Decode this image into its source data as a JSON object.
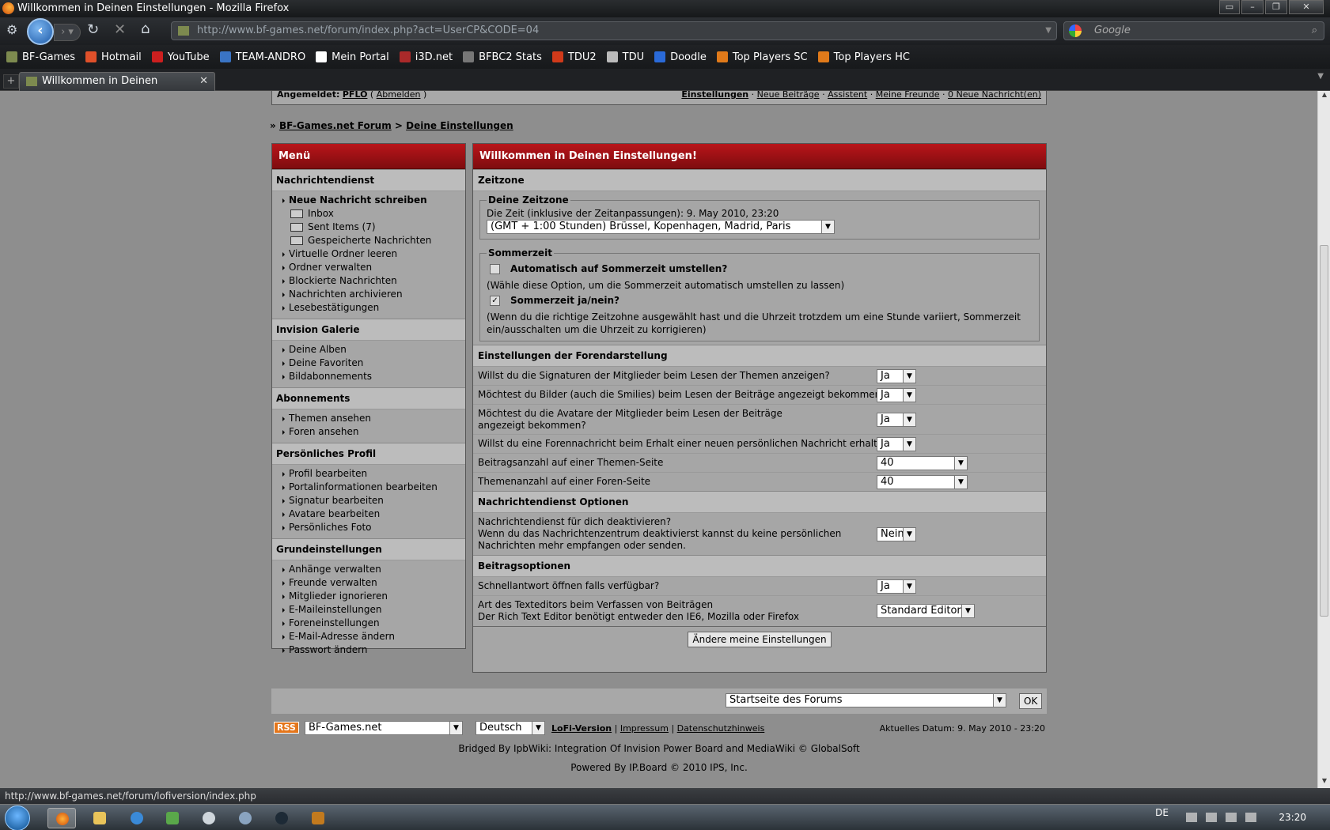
{
  "window": {
    "title": "Willkommen in Deinen Einstellungen - Mozilla Firefox"
  },
  "nav": {
    "url": "http://www.bf-games.net/forum/index.php?act=UserCP&CODE=04",
    "search_placeholder": "Google"
  },
  "bookmarks": [
    {
      "label": "BF-Games",
      "color": "#7d8a4f"
    },
    {
      "label": "Hotmail",
      "color": "#e0502a"
    },
    {
      "label": "YouTube",
      "color": "#cc1f1f"
    },
    {
      "label": "TEAM-ANDRO",
      "color": "#3a74c4"
    },
    {
      "label": "Mein Portal",
      "color": "#ffffff"
    },
    {
      "label": "i3D.net",
      "color": "#aa2a2a"
    },
    {
      "label": "BFBC2 Stats",
      "color": "#777777"
    },
    {
      "label": "TDU2",
      "color": "#d03a1a"
    },
    {
      "label": "TDU",
      "color": "#bbbbbb"
    },
    {
      "label": "Doodle",
      "color": "#2a6ad8"
    },
    {
      "label": "Top Players SC",
      "color": "#e07a1a"
    },
    {
      "label": "Top Players HC",
      "color": "#e07a1a"
    }
  ],
  "tab": {
    "label": "Willkommen in Deinen Einstellun..."
  },
  "userbar": {
    "left_prefix": "Angemeldet:",
    "user": "PFLO",
    "logout": "Abmelden",
    "links": [
      "Einstellungen",
      "Neue Beiträge",
      "Assistent",
      "Meine Freunde",
      "0 Neue Nachricht(en)"
    ]
  },
  "breadcrumb": {
    "root": "BF-Games.net Forum",
    "current": "Deine Einstellungen"
  },
  "menu": {
    "title": "Menü",
    "sections": [
      {
        "title": "Nachrichtendienst"
      },
      {
        "title": "Invision Galerie"
      },
      {
        "title": "Abonnements"
      },
      {
        "title": "Persönliches Profil"
      },
      {
        "title": "Grundeinstellungen"
      }
    ],
    "messenger": {
      "new_message": "Neue Nachricht schreiben",
      "inbox": "Inbox",
      "sent": "Sent Items (7)",
      "saved": "Gespeicherte Nachrichten",
      "items": [
        "Virtuelle Ordner leeren",
        "Ordner verwalten",
        "Blockierte Nachrichten",
        "Nachrichten archivieren",
        "Lesebestätigungen"
      ]
    },
    "gallery": [
      "Deine Alben",
      "Deine Favoriten",
      "Bildabonnements"
    ],
    "subscriptions": [
      "Themen ansehen",
      "Foren ansehen"
    ],
    "profile": [
      "Profil bearbeiten",
      "Portalinformationen bearbeiten",
      "Signatur bearbeiten",
      "Avatare bearbeiten",
      "Persönliches Foto"
    ],
    "basic": [
      "Anhänge verwalten",
      "Freunde verwalten",
      "Mitglieder ignorieren",
      "E-Maileinstellungen",
      "Foreneinstellungen",
      "E-Mail-Adresse ändern",
      "Passwort ändern"
    ]
  },
  "main": {
    "title": "Willkommen in Deinen Einstellungen!",
    "timezone": {
      "section": "Zeitzone",
      "legend": "Deine Zeitzone",
      "time_text": "Die Zeit (inklusive der Zeitanpassungen): 9. May 2010, 23:20",
      "selected": "(GMT + 1:00 Stunden) Brüssel, Kopenhagen, Madrid, Paris"
    },
    "dst": {
      "legend": "Sommerzeit",
      "auto_label": "Automatisch auf Sommerzeit umstellen?",
      "auto_checked": false,
      "auto_hint": "(Wähle diese Option, um die Sommerzeit automatisch umstellen zu lassen)",
      "on_label": "Sommerzeit ja/nein?",
      "on_checked": true,
      "on_hint": "(Wenn du die richtige Zeitzohne ausgewählt hast und die Uhrzeit trotzdem um eine Stunde variiert, Sommerzeit ein/ausschalten um die Uhrzeit zu korrigieren)"
    },
    "display": {
      "section": "Einstellungen der Forendarstellung",
      "rows": [
        {
          "label": "Willst du die Signaturen der Mitglieder beim Lesen der Themen anzeigen?",
          "value": "Ja"
        },
        {
          "label": "Möchtest du Bilder (auch die Smilies) beim Lesen der Beiträge angezeigt bekommen?",
          "value": "Ja"
        },
        {
          "label": "Möchtest du die Avatare der Mitglieder beim Lesen der Beiträge angezeigt bekommen?",
          "value": "Ja"
        },
        {
          "label": "Willst du eine Forennachricht beim Erhalt einer neuen persönlichen Nachricht erhalten?",
          "value": "Ja"
        },
        {
          "label": "Beitragsanzahl auf einer Themen-Seite",
          "value": "40"
        },
        {
          "label": "Themenanzahl auf einer Foren-Seite",
          "value": "40"
        }
      ]
    },
    "messenger_options": {
      "section": "Nachrichtendienst Optionen",
      "label": "Nachrichtendienst für dich deaktivieren?\nWenn du das Nachrichtenzentrum deaktivierst kannst du keine persönlichen Nachrichten mehr empfangen oder senden.",
      "label_l1": "Nachrichtendienst für dich deaktivieren?",
      "label_l2": "Wenn du das Nachrichtenzentrum deaktivierst kannst du keine persönlichen",
      "label_l3": "Nachrichten mehr empfangen oder senden.",
      "value": "Nein"
    },
    "post_options": {
      "section": "Beitragsoptionen",
      "quick_label": "Schnellantwort öffnen falls verfügbar?",
      "quick_value": "Ja",
      "editor_l1": "Art des Texteditors beim Verfassen von Beiträgen",
      "editor_l2": "Der Rich Text Editor benötigt entweder den IE6, Mozilla oder Firefox",
      "editor_value": "Standard Editor"
    },
    "submit": "Ändere meine Einstellungen"
  },
  "footer": {
    "jump_value": "Startseite des Forums",
    "ok": "OK",
    "rss": "RSS",
    "skin": "BF-Games.net",
    "language": "Deutsch",
    "lofi": "LoFi-Version",
    "impressum": "Impressum",
    "privacy": "Datenschutzhinweis",
    "date": "Aktuelles Datum: 9. May 2010 - 23:20",
    "credit1": "Bridged By IpbWiki: Integration Of Invision Power Board and MediaWiki © GlobalSoft",
    "credit2": "Powered By IP.Board © 2010  IPS, Inc."
  },
  "status": {
    "text": "http://www.bf-games.net/forum/lofiversion/index.php"
  },
  "taskbar": {
    "lang": "DE",
    "clock": "23:20"
  }
}
